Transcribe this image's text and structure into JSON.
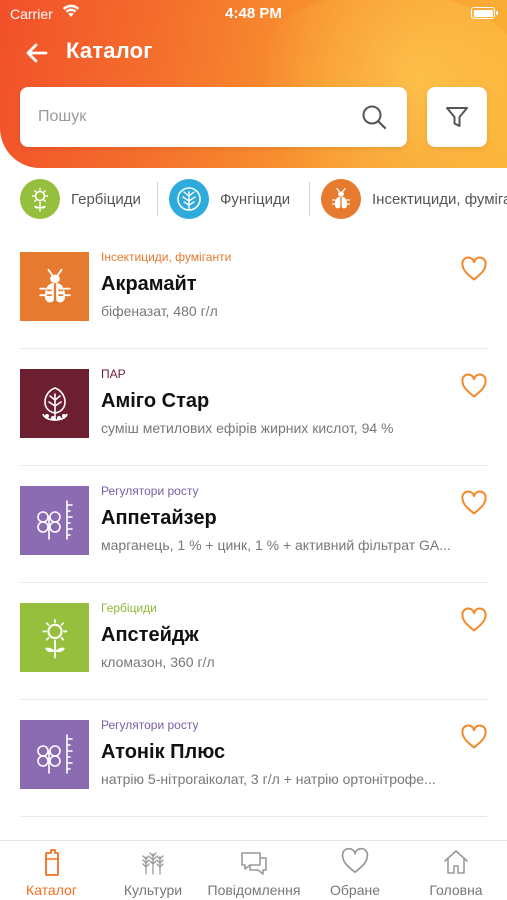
{
  "status": {
    "carrier": "Carrier",
    "time": "4:48 PM"
  },
  "header": {
    "title": "Каталог"
  },
  "search": {
    "placeholder": "Пошук"
  },
  "categories": [
    {
      "label": "Гербіциди",
      "icon": "herbicide-icon",
      "color": "#95bf3c"
    },
    {
      "label": "Фунгіциди",
      "icon": "fungicide-icon",
      "color": "#2eaadc"
    },
    {
      "label": "Інсектициди, фуміганти",
      "icon": "insecticide-icon",
      "color": "#e67a2e"
    }
  ],
  "products": [
    {
      "category": "Інсектициди, фуміганти",
      "category_color": "#e67a2e",
      "name": "Акрамайт",
      "description": "біфеназат, 480 г/л",
      "icon": "insecticide-icon",
      "thumb_color": "#e67a2e"
    },
    {
      "category": "ПАР",
      "category_color": "#6d1f32",
      "name": "Аміго Стар",
      "description": "суміш метилових ефірів жирних кислот, 94 %",
      "icon": "adjuvant-icon",
      "thumb_color": "#6d1f32"
    },
    {
      "category": "Регулятори росту",
      "category_color": "#7b5ea7",
      "name": "Аппетайзер",
      "description": "марганець, 1 % + цинк, 1 % + активний фільтрат GA...",
      "icon": "growth-regulator-icon",
      "thumb_color": "#8b6bb2"
    },
    {
      "category": "Гербіциди",
      "category_color": "#8fb73a",
      "name": "Апстейдж",
      "description": "кломазон, 360 г/л",
      "icon": "herbicide-icon",
      "thumb_color": "#95bf3c"
    },
    {
      "category": "Регулятори росту",
      "category_color": "#7b5ea7",
      "name": "Атонік Плюс",
      "description": "натрію 5-нітрогаіколат, 3 г/л + натрію ортонітрофе...",
      "icon": "growth-regulator-icon",
      "thumb_color": "#8b6bb2"
    }
  ],
  "tabs": [
    {
      "label": "Каталог",
      "icon": "catalog-icon",
      "active": true
    },
    {
      "label": "Культури",
      "icon": "crops-icon",
      "active": false
    },
    {
      "label": "Повідомлення",
      "icon": "messages-icon",
      "active": false
    },
    {
      "label": "Обране",
      "icon": "favorites-icon",
      "active": false
    },
    {
      "label": "Головна",
      "icon": "home-icon",
      "active": false
    }
  ],
  "colors": {
    "accent": "#f26f21",
    "heart": "#f08a2c"
  }
}
